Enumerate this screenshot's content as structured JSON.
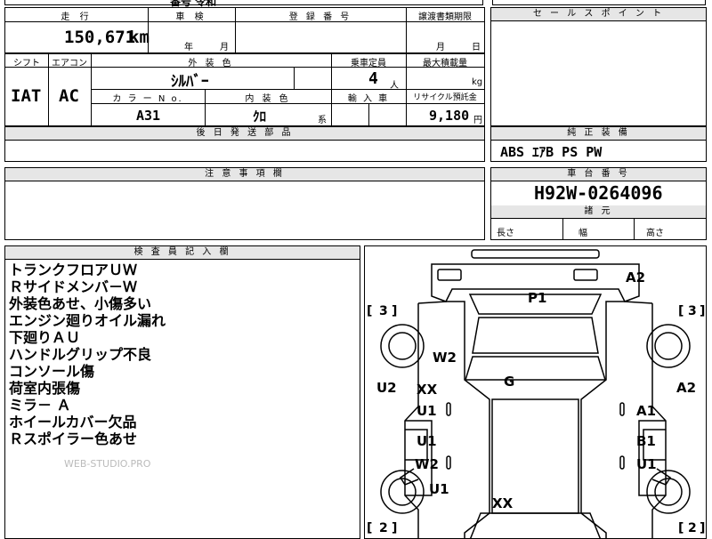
{
  "top_strip": {
    "partial_text": "番号 令和"
  },
  "row1": {
    "mileage_header": "走 行",
    "shaken_header": "車 検",
    "registration_header": "登 録 番 号",
    "transfer_header": "譲渡書類期限",
    "mileage_value": "150,671",
    "mileage_unit": "km",
    "shaken_year": "年",
    "shaken_month": "月",
    "transfer_month": "月",
    "transfer_day": "日"
  },
  "row2": {
    "shift_header": "シフト",
    "ac_header": "エアコン",
    "exterior_header": "外 装 色",
    "capacity_header": "乗車定員",
    "load_header": "最大積載量",
    "shift_value": "IAT",
    "ac_value": "AC",
    "exterior_value": "ｼﾙﾊﾞｰ",
    "capacity_value": "4",
    "capacity_unit": "人",
    "load_unit": "kg",
    "color_no_header": "カ ラ ー N o.",
    "interior_header": "内 装 色",
    "import_header": "輸 入 車",
    "recycle_header": "リサイクル預託金",
    "color_no_value": "A31",
    "interior_value": "ｸﾛ",
    "interior_suffix": "系",
    "recycle_value": "9,180",
    "recycle_unit": "円"
  },
  "later_parts_header": "後 日 発 送 部 品",
  "sales_point_header": "セ ー ル ス ポ イ ン ト",
  "equipment": {
    "header": "純 正 装 備",
    "value": "ABS ｴｱB PS PW"
  },
  "caution_header": "注 意 事 項 欄",
  "chassis": {
    "header": "車 台 番 号",
    "value": "H92W-0264096"
  },
  "dimensions": {
    "header": "諸 元",
    "length": "長さ",
    "width": "幅",
    "height": "高さ"
  },
  "inspector": {
    "header": "検 査 員 記 入 欄",
    "notes": [
      "トランクフロアＵＷ",
      "Ｒサイドメンバ－Ｗ",
      "外装色あせ、小傷多い",
      "エンジン廻りオイル漏れ",
      "下廻りＡＵ",
      "ハンドルグリップ不良",
      "コンソール傷",
      "荷室内張傷",
      "ミラ－ Ａ",
      "ホイールカバー欠品",
      "Ｒスポイラー色あせ"
    ],
    "watermark": "WEB-STUDIO.PRO"
  },
  "car_map": {
    "marks": {
      "a2_top": "A2",
      "p1": "P1",
      "w2_left": "W2",
      "g": "G",
      "u2_left": "U2",
      "xx_left": "XX",
      "u1_left_top": "U1",
      "u1_left_mid": "U1",
      "w2_left_low": "W2",
      "u1_left_bottom": "U1",
      "xx_bottom": "XX",
      "a2_right": "A2",
      "a1_right": "A1",
      "b1_right": "B1",
      "u1_right": "U1"
    },
    "tire_left_top": "3",
    "tire_right_top": "3",
    "tire_left_bottom": "2",
    "tire_right_bottom": "2"
  }
}
